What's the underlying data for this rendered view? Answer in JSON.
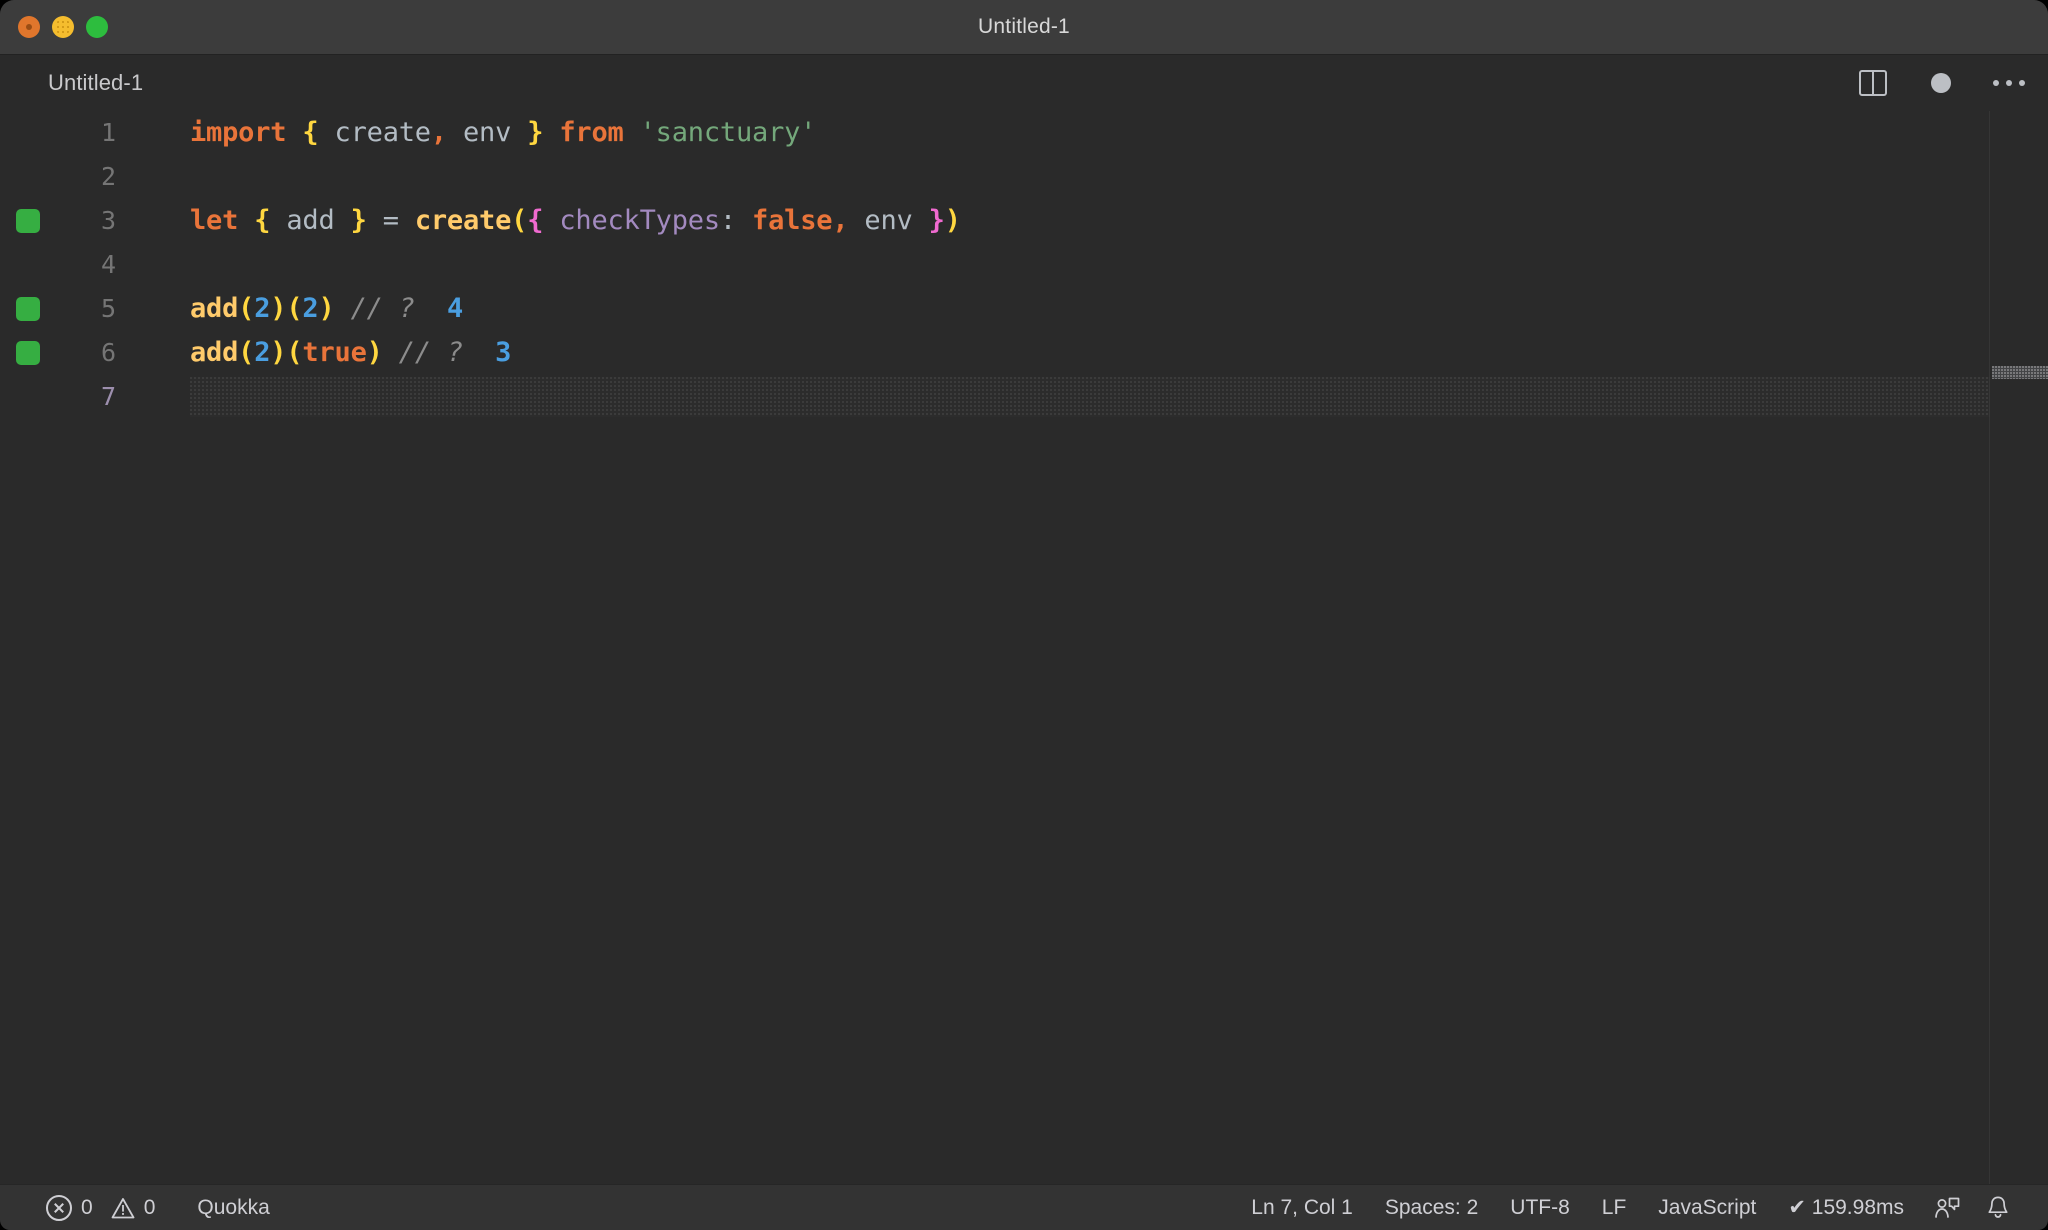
{
  "window": {
    "title": "Untitled-1",
    "traffic_lights": [
      "close",
      "minimize",
      "zoom"
    ]
  },
  "tabbar": {
    "tab_label": "Untitled-1",
    "actions": [
      {
        "name": "split-editor-icon",
        "label": "Split Editor"
      },
      {
        "name": "unsaved-dot-icon",
        "label": "Unsaved"
      },
      {
        "name": "more-actions-icon",
        "label": "More Actions..."
      }
    ]
  },
  "editor": {
    "language": "JavaScript",
    "lines": [
      {
        "number": "1",
        "marker": false,
        "active": false,
        "tokens": [
          {
            "c": "t-kw",
            "t": "import"
          },
          {
            "c": "t-op",
            "t": " "
          },
          {
            "c": "t-brace",
            "t": "{"
          },
          {
            "c": "t-id",
            "t": " create"
          },
          {
            "c": "t-kw",
            "t": ","
          },
          {
            "c": "t-id",
            "t": " env "
          },
          {
            "c": "t-brace",
            "t": "}"
          },
          {
            "c": "t-op",
            "t": " "
          },
          {
            "c": "t-kw",
            "t": "from"
          },
          {
            "c": "t-op",
            "t": " "
          },
          {
            "c": "t-str",
            "t": "'sanctuary'"
          }
        ]
      },
      {
        "number": "2",
        "marker": false,
        "active": false,
        "tokens": []
      },
      {
        "number": "3",
        "marker": true,
        "active": false,
        "tokens": [
          {
            "c": "t-kw",
            "t": "let"
          },
          {
            "c": "t-op",
            "t": " "
          },
          {
            "c": "t-brace",
            "t": "{"
          },
          {
            "c": "t-id",
            "t": " add "
          },
          {
            "c": "t-brace",
            "t": "}"
          },
          {
            "c": "t-op",
            "t": " = "
          },
          {
            "c": "t-fn",
            "t": "create"
          },
          {
            "c": "t-paren",
            "t": "("
          },
          {
            "c": "t-magenta",
            "t": "{"
          },
          {
            "c": "t-op",
            "t": " "
          },
          {
            "c": "t-prop",
            "t": "checkTypes"
          },
          {
            "c": "t-op",
            "t": ": "
          },
          {
            "c": "t-kw",
            "t": "false"
          },
          {
            "c": "t-kw",
            "t": ","
          },
          {
            "c": "t-id",
            "t": " env "
          },
          {
            "c": "t-magenta",
            "t": "}"
          },
          {
            "c": "t-paren",
            "t": ")"
          }
        ]
      },
      {
        "number": "4",
        "marker": false,
        "active": false,
        "tokens": []
      },
      {
        "number": "5",
        "marker": true,
        "active": false,
        "tokens": [
          {
            "c": "t-fn",
            "t": "add"
          },
          {
            "c": "t-paren",
            "t": "("
          },
          {
            "c": "t-num",
            "t": "2"
          },
          {
            "c": "t-paren",
            "t": ")("
          },
          {
            "c": "t-num",
            "t": "2"
          },
          {
            "c": "t-paren",
            "t": ")"
          },
          {
            "c": "t-op",
            "t": " "
          },
          {
            "c": "t-com",
            "t": "// ?"
          },
          {
            "c": "t-op",
            "t": "  "
          },
          {
            "c": "t-res",
            "t": "4"
          }
        ]
      },
      {
        "number": "6",
        "marker": true,
        "active": false,
        "tokens": [
          {
            "c": "t-fn",
            "t": "add"
          },
          {
            "c": "t-paren",
            "t": "("
          },
          {
            "c": "t-num",
            "t": "2"
          },
          {
            "c": "t-paren",
            "t": ")("
          },
          {
            "c": "t-kw",
            "t": "true"
          },
          {
            "c": "t-paren",
            "t": ")"
          },
          {
            "c": "t-op",
            "t": " "
          },
          {
            "c": "t-com",
            "t": "// ?"
          },
          {
            "c": "t-op",
            "t": "  "
          },
          {
            "c": "t-res",
            "t": "3"
          }
        ]
      },
      {
        "number": "7",
        "marker": false,
        "active": true,
        "tokens": []
      }
    ]
  },
  "statusbar": {
    "errors_label": "0",
    "warnings_label": "0",
    "quokka_label": "Quokka",
    "cursor_label": "Ln 7, Col 1",
    "indent_label": "Spaces: 2",
    "encoding_label": "UTF-8",
    "eol_label": "LF",
    "language_label": "JavaScript",
    "runtime_label": "✔ 159.98ms",
    "feedback_icon": "feedback-smiley-icon",
    "bell_icon": "notifications-bell-icon"
  },
  "colors": {
    "window_bg": "#2a2a2a",
    "titlebar_bg": "#3c3c3c",
    "statusbar_bg": "#333333",
    "marker_green": "#36ae42",
    "keyword_orange": "#e9743a",
    "brace_yellow": "#ffd740",
    "magenta": "#f06ad0",
    "function_tan": "#ffcb6b",
    "property_purple": "#a38ac0",
    "string_green": "#74a87b",
    "number_blue": "#4a9ee0",
    "comment_gray": "#8c8c8c"
  }
}
